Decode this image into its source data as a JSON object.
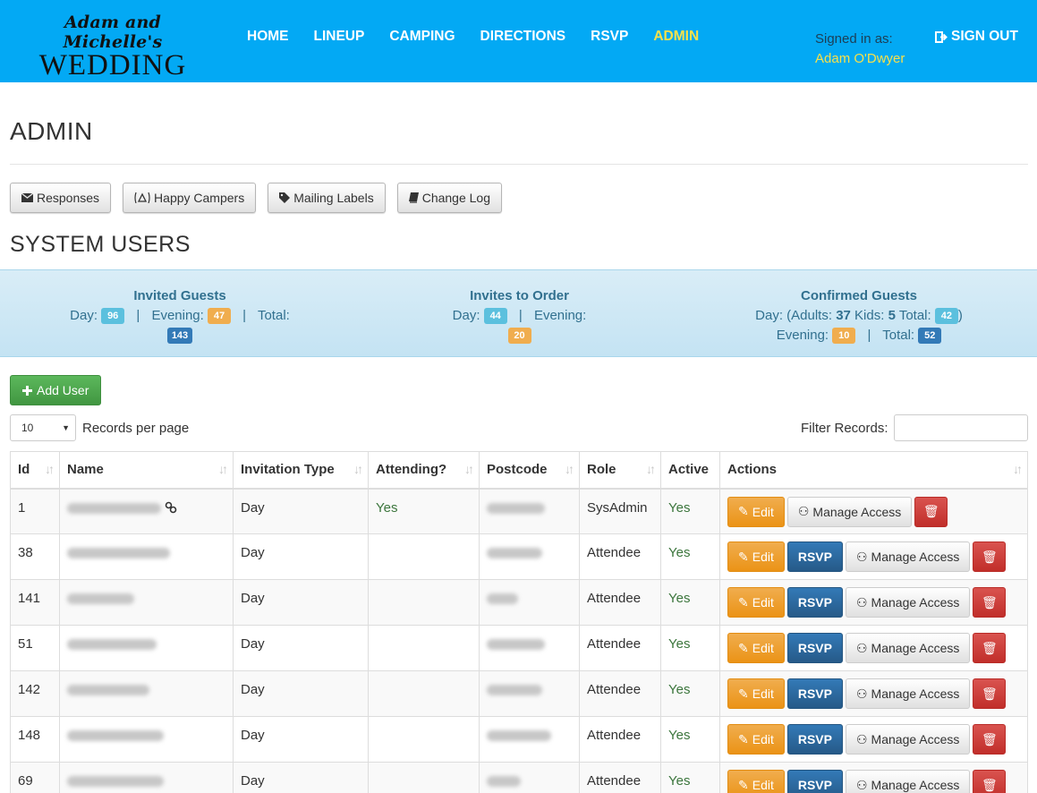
{
  "header": {
    "logo_top": "Adam and Michelle's",
    "logo_main": "WEDDING",
    "nav": [
      "HOME",
      "LINEUP",
      "CAMPING",
      "DIRECTIONS",
      "RSVP",
      "ADMIN"
    ],
    "active_nav": "ADMIN",
    "signed_label": "Signed in as:",
    "signed_user": "Adam O'Dwyer",
    "signout": "SIGN OUT"
  },
  "page_title": "ADMIN",
  "toolbar": {
    "responses": "Responses",
    "happy_campers": "Happy Campers",
    "mailing_labels": "Mailing Labels",
    "change_log": "Change Log"
  },
  "section_title": "SYSTEM USERS",
  "stats": {
    "invited": {
      "title": "Invited Guests",
      "day_label": "Day:",
      "day": "96",
      "evening_label": "Evening:",
      "evening": "47",
      "total_label": "Total:",
      "total": "143"
    },
    "invites_to_order": {
      "title": "Invites to Order",
      "day_label": "Day:",
      "day": "44",
      "evening_label": "Evening:",
      "evening": "20"
    },
    "confirmed": {
      "title": "Confirmed Guests",
      "day_prefix": "Day: (Adults:",
      "adults": "37",
      "kids_label": "Kids:",
      "kids": "5",
      "total_label": "Total:",
      "day_total": "42",
      "close": ")",
      "evening_label": "Evening:",
      "evening": "10",
      "total2_label": "Total:",
      "total": "52"
    }
  },
  "add_user": "Add User",
  "records_select": "10",
  "records_label": "Records per page",
  "filter_label": "Filter Records:",
  "table": {
    "headers": [
      "Id",
      "Name",
      "Invitation Type",
      "Attending?",
      "Postcode",
      "Role",
      "Active",
      "Actions"
    ],
    "rows": [
      {
        "id": "1",
        "type": "Day",
        "attending": "Yes",
        "role": "SysAdmin",
        "active": "Yes"
      },
      {
        "id": "38",
        "type": "Day",
        "attending": "",
        "role": "Attendee",
        "active": "Yes"
      },
      {
        "id": "141",
        "type": "Day",
        "attending": "",
        "role": "Attendee",
        "active": "Yes"
      },
      {
        "id": "51",
        "type": "Day",
        "attending": "",
        "role": "Attendee",
        "active": "Yes"
      },
      {
        "id": "142",
        "type": "Day",
        "attending": "",
        "role": "Attendee",
        "active": "Yes"
      },
      {
        "id": "148",
        "type": "Day",
        "attending": "",
        "role": "Attendee",
        "active": "Yes"
      },
      {
        "id": "69",
        "type": "Day",
        "attending": "",
        "role": "Attendee",
        "active": "Yes"
      }
    ],
    "edit_label": "Edit",
    "rsvp_label": "RSVP",
    "manage_label": "Manage Access"
  }
}
